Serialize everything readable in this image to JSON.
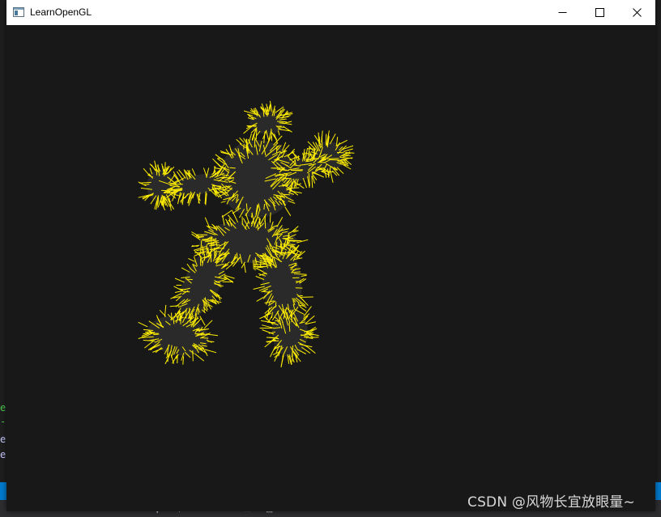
{
  "window": {
    "title": "LearnOpenGL",
    "icons": {
      "app": "opengl-window-icon",
      "minimize": "minimize-icon",
      "maximize": "maximize-icon",
      "close": "close-icon"
    }
  },
  "viewport": {
    "clear_color": "#181818",
    "normal_line_color": "#ffee00",
    "model_color": "#2a2a2a"
  },
  "background_ide": {
    "lines": [
      {
        "text": "e",
        "color": "#4ec94e"
      },
      {
        "text": "-",
        "color": "#4ec94e"
      },
      {
        "text": "ea",
        "color": "#c8c8ff"
      },
      {
        "text": "e",
        "color": "#c8c8ff"
      }
    ],
    "toolbar_glyphs": [
      "▼",
      "⊢",
      "≡",
      "≡",
      "▬",
      "⊡"
    ],
    "status_bar_color": "#007acc"
  },
  "watermark": {
    "text": "CSDN @风物长宜放眼量~"
  }
}
